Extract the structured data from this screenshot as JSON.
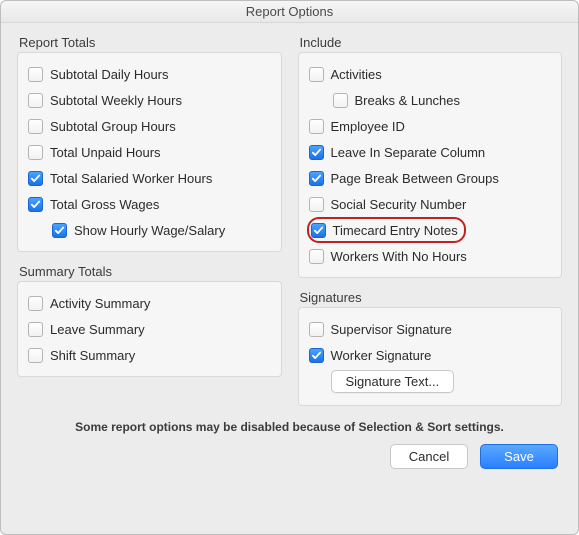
{
  "title": "Report Options",
  "groups": {
    "reportTotals": {
      "title": "Report Totals",
      "items": [
        {
          "label": "Subtotal Daily Hours",
          "checked": false
        },
        {
          "label": "Subtotal Weekly Hours",
          "checked": false
        },
        {
          "label": "Subtotal Group Hours",
          "checked": false
        },
        {
          "label": "Total Unpaid Hours",
          "checked": false
        },
        {
          "label": "Total Salaried Worker Hours",
          "checked": true
        },
        {
          "label": "Total Gross Wages",
          "checked": true
        },
        {
          "label": "Show Hourly Wage/Salary",
          "checked": true,
          "indent": true
        }
      ]
    },
    "summaryTotals": {
      "title": "Summary Totals",
      "items": [
        {
          "label": "Activity Summary",
          "checked": false
        },
        {
          "label": "Leave Summary",
          "checked": false
        },
        {
          "label": "Shift Summary",
          "checked": false
        }
      ]
    },
    "include": {
      "title": "Include",
      "items": [
        {
          "label": "Activities",
          "checked": false
        },
        {
          "label": "Breaks & Lunches",
          "checked": false,
          "indent": true
        },
        {
          "label": "Employee ID",
          "checked": false
        },
        {
          "label": "Leave In Separate Column",
          "checked": true
        },
        {
          "label": "Page Break Between Groups",
          "checked": true
        },
        {
          "label": "Social Security Number",
          "checked": false
        },
        {
          "label": "Timecard Entry Notes",
          "checked": true,
          "highlight": true
        },
        {
          "label": "Workers With No Hours",
          "checked": false
        }
      ]
    },
    "signatures": {
      "title": "Signatures",
      "items": [
        {
          "label": "Supervisor Signature",
          "checked": false
        },
        {
          "label": "Worker Signature",
          "checked": true
        }
      ],
      "button": "Signature Text..."
    }
  },
  "footerNote": "Some report options may be disabled because of Selection & Sort settings.",
  "buttons": {
    "cancel": "Cancel",
    "save": "Save"
  }
}
